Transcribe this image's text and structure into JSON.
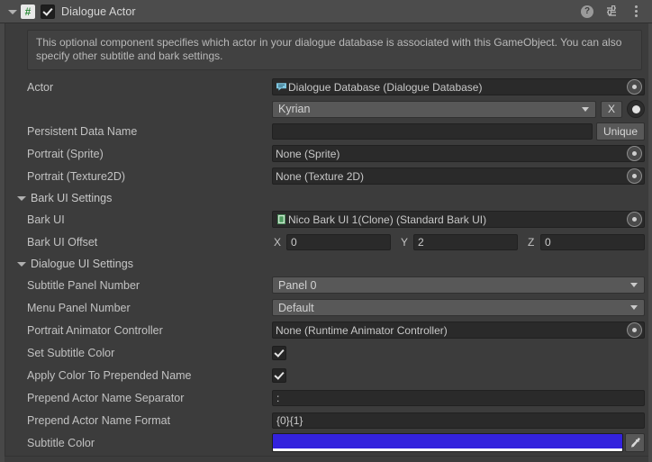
{
  "component": {
    "title": "Dialogue Actor",
    "enabled_checkbox": true,
    "expanded": true,
    "script_icon_glyph": "#",
    "header_icons": [
      {
        "name": "help-icon",
        "glyph": "?"
      },
      {
        "name": "preset-icon",
        "glyph": "preset"
      },
      {
        "name": "more-menu-icon",
        "glyph": "kebab"
      }
    ],
    "help_text": "This optional component specifies which actor in your dialogue database is associated with this GameObject. You can also specify other subtitle and bark settings."
  },
  "fields": {
    "actor": {
      "label": "Actor",
      "object_value": "Dialogue Database (Dialogue Database)",
      "object_icon": "dialogue-database-icon",
      "dropdown_value": "Kyrian",
      "clear_button": "X"
    },
    "persistent_data_name": {
      "label": "Persistent Data Name",
      "value": "",
      "button": "Unique"
    },
    "portrait_sprite": {
      "label": "Portrait (Sprite)",
      "value": "None (Sprite)"
    },
    "portrait_texture2d": {
      "label": "Portrait (Texture2D)",
      "value": "None (Texture 2D)"
    }
  },
  "bark_ui_settings": {
    "section_label": "Bark UI Settings",
    "bark_ui": {
      "label": "Bark UI",
      "value": "Nico Bark UI 1(Clone) (Standard Bark UI)",
      "object_icon": "prefab-icon"
    },
    "bark_ui_offset": {
      "label": "Bark UI Offset",
      "axes": [
        "X",
        "Y",
        "Z"
      ],
      "values": [
        "0",
        "2",
        "0"
      ]
    }
  },
  "dialogue_ui_settings": {
    "section_label": "Dialogue UI Settings",
    "subtitle_panel_number": {
      "label": "Subtitle Panel Number",
      "value": "Panel 0"
    },
    "menu_panel_number": {
      "label": "Menu Panel Number",
      "value": "Default"
    },
    "portrait_animator_controller": {
      "label": "Portrait Animator Controller",
      "value": "None (Runtime Animator Controller)"
    },
    "set_subtitle_color": {
      "label": "Set Subtitle Color",
      "checked": true
    },
    "apply_color_to_prepended_name": {
      "label": "Apply Color To Prepended Name",
      "checked": true
    },
    "prepend_actor_name_separator": {
      "label": "Prepend Actor Name Separator",
      "value": ":"
    },
    "prepend_actor_name_format": {
      "label": "Prepend Actor Name Format",
      "value": "{0}{1}"
    },
    "subtitle_color": {
      "label": "Subtitle Color",
      "hex": "#3322DD",
      "alpha_hex": "#FFFFFF"
    }
  }
}
